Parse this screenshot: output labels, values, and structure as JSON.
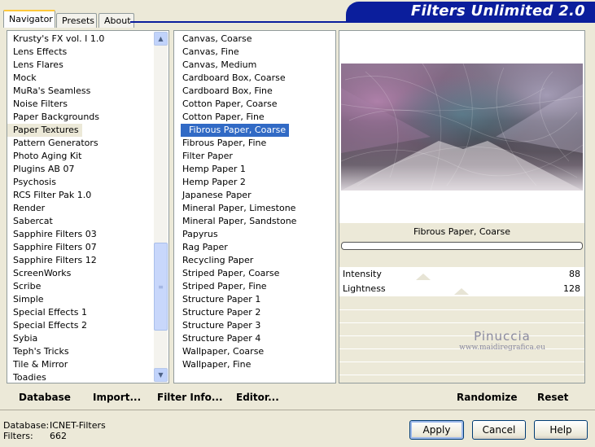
{
  "tabs": [
    {
      "label": "Navigator",
      "active": true
    },
    {
      "label": "Presets",
      "active": false
    },
    {
      "label": "About",
      "active": false
    }
  ],
  "banner": {
    "title": "Filters Unlimited 2.0"
  },
  "categories": {
    "items": [
      "Krusty's FX vol. I 1.0",
      "Lens Effects",
      "Lens Flares",
      "Mock",
      "MuRa's Seamless",
      "Noise Filters",
      "Paper Backgrounds",
      "Paper Textures",
      "Pattern Generators",
      "Photo Aging Kit",
      "Plugins AB 07",
      "Psychosis",
      "RCS Filter Pak 1.0",
      "Render",
      "Sabercat",
      "Sapphire Filters 03",
      "Sapphire Filters 07",
      "Sapphire Filters 12",
      "ScreenWorks",
      "Scribe",
      "Simple",
      "Special Effects 1",
      "Special Effects 2",
      "Sybia",
      "Teph's Tricks",
      "Tile & Mirror",
      "Toadies"
    ],
    "selected": "Paper Textures"
  },
  "filters": {
    "items": [
      "Canvas, Coarse",
      "Canvas, Fine",
      "Canvas, Medium",
      "Cardboard Box, Coarse",
      "Cardboard Box, Fine",
      "Cotton Paper, Coarse",
      "Cotton Paper, Fine",
      "Fibrous Paper, Coarse",
      "Fibrous Paper, Fine",
      "Filter Paper",
      "Hemp Paper 1",
      "Hemp Paper 2",
      "Japanese Paper",
      "Mineral Paper, Limestone",
      "Mineral Paper, Sandstone",
      "Papyrus",
      "Rag Paper",
      "Recycling Paper",
      "Striped Paper, Coarse",
      "Striped Paper, Fine",
      "Structure Paper 1",
      "Structure Paper 2",
      "Structure Paper 3",
      "Structure Paper 4",
      "Wallpaper, Coarse",
      "Wallpaper, Fine"
    ],
    "selected": "Fibrous Paper, Coarse"
  },
  "preview": {
    "filter_name": "Fibrous Paper, Coarse",
    "params": [
      {
        "label": "Intensity",
        "value": "88",
        "level": 88
      },
      {
        "label": "Lightness",
        "value": "128",
        "level": 128
      }
    ],
    "watermark_line1": "Pinuccia",
    "watermark_line2": "www.maidiregrafica.eu"
  },
  "toolbar": {
    "database": "Database",
    "import": "Import...",
    "filter_info": "Filter Info...",
    "editor": "Editor...",
    "randomize": "Randomize",
    "reset": "Reset"
  },
  "status": {
    "database_label": "Database:",
    "database_value": "ICNET-Filters",
    "filters_label": "Filters:",
    "filters_value": "662"
  },
  "buttons": {
    "apply": "Apply",
    "cancel": "Cancel",
    "help": "Help"
  },
  "colors": {
    "banner": "#0b1e9c",
    "selection": "#316ac5",
    "window": "#ece9d8"
  }
}
